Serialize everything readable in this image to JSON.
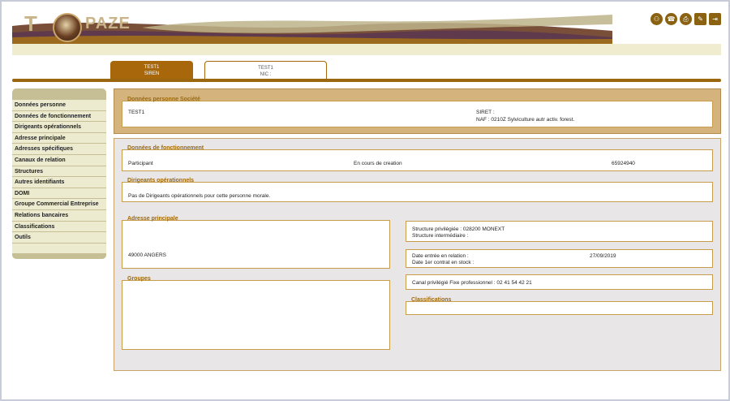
{
  "header": {
    "logo_text": "PAZE",
    "logo_t": "T",
    "icons": [
      "network-icon",
      "phone-icon",
      "print-icon",
      "edit-icon",
      "exit-icon"
    ]
  },
  "tabs": [
    {
      "line1": "TEST1",
      "line2": "SIREN"
    },
    {
      "line1": "TEST1",
      "line2": "NIC :"
    }
  ],
  "sidebar": {
    "items": [
      "Données personne",
      "Données de fonctionnement",
      "Dirigeants opérationnels",
      "Adresse principale",
      "Adresses spécifiques",
      "Canaux de relation",
      "Structures",
      "Autres identifiants",
      "DOMI",
      "Groupe Commercial Entreprise",
      "Relations bancaires",
      "Classifications",
      "Outils"
    ]
  },
  "donnees_personne": {
    "title": "Données personne Société",
    "name": "TEST1",
    "siret": "SIRET :",
    "naf": "NAF : 0210Z Sylviculture autr activ. forest."
  },
  "donnees_fonctionnement": {
    "title": "Données de fonctionnement",
    "role": "Participant",
    "status": "En cours de creation",
    "number": "65924940"
  },
  "dirigeants": {
    "title": "Dirigeants opérationnels",
    "text": "Pas de Dirigeants opérationnels pour cette personne morale."
  },
  "adresse": {
    "title": "Adresse principale",
    "city": "49000 ANGERS"
  },
  "groupes": {
    "title": "Groupes"
  },
  "structure": {
    "privilegiee": "Structure privilégiée : 028200 MONEXT",
    "intermediaire": "Structure intermédiaire :"
  },
  "dates": {
    "entree_label": "Date entrée en relation :",
    "entree_value": "27/09/2019",
    "contrat_label": "Date 1er contrat en stock :"
  },
  "canal": {
    "text": "Canal privilégié Fixe professionnel : 02 41 54 42 21"
  },
  "classifications": {
    "title": "Classifications"
  }
}
